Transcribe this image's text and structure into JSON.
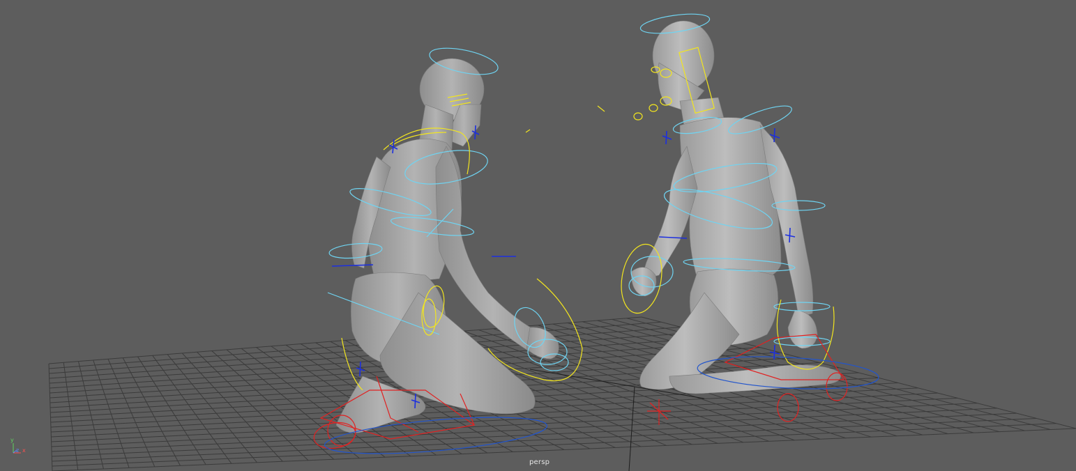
{
  "viewport": {
    "camera_label": "persp",
    "axis_gizmo": {
      "x": "x",
      "y": "y",
      "z": "z"
    }
  },
  "colors": {
    "background": "#5d5d5d",
    "grid": "#3a3a3a",
    "mesh": "#a7a7a7",
    "nurbs_control": "#6fd4f2",
    "selected_control": "#f2e51f",
    "ik_control": "#e02222",
    "locator": "#1c2fe0"
  },
  "objects": {
    "left_character": "character-mesh",
    "right_character": "character-mesh"
  }
}
